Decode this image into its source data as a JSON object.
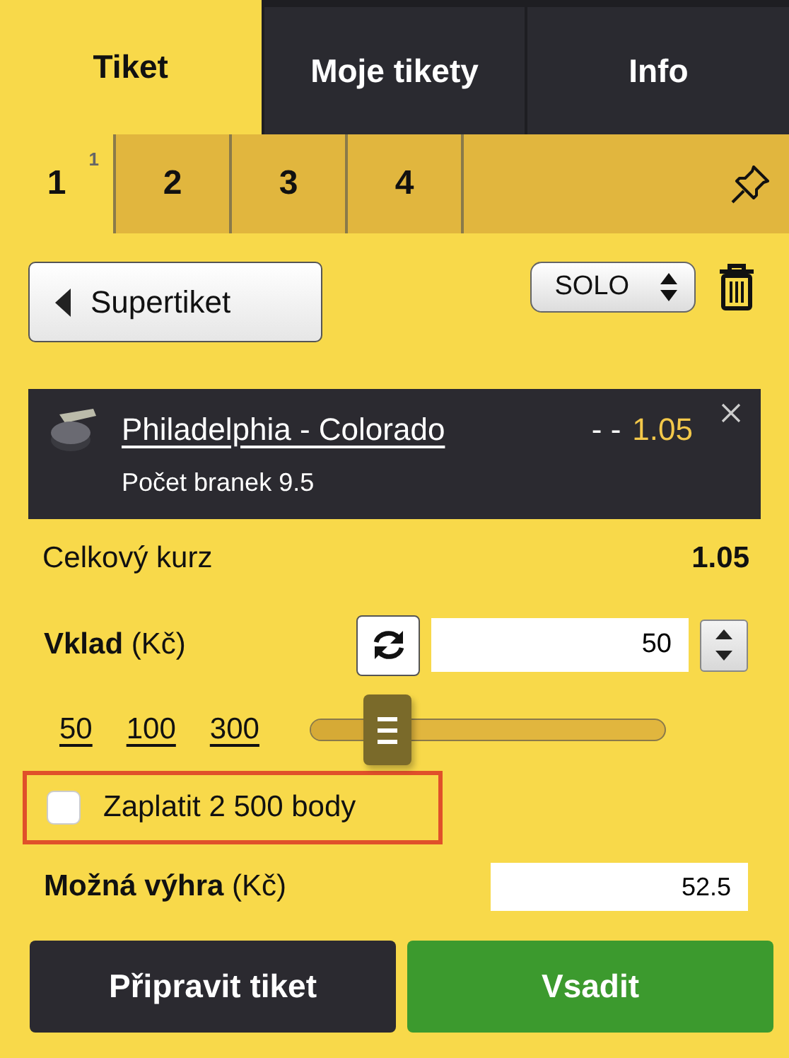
{
  "main_tabs": [
    {
      "label": "Tiket",
      "selected": true
    },
    {
      "label": "Moje tikety",
      "selected": false
    },
    {
      "label": "Info",
      "selected": false
    }
  ],
  "ticket_tabs": [
    {
      "label": "1",
      "count": "1",
      "selected": true
    },
    {
      "label": "2",
      "selected": false
    },
    {
      "label": "3",
      "selected": false
    },
    {
      "label": "4",
      "selected": false
    }
  ],
  "supertiket_button": "Supertiket",
  "mode_select": {
    "value": "SOLO"
  },
  "bets": [
    {
      "match": "Philadelphia - Colorado",
      "market": "Počet branek 9.5",
      "odds_prefix": "- -",
      "odds": "1.05"
    }
  ],
  "total_odds": {
    "label": "Celkový kurz",
    "value": "1.05"
  },
  "stake": {
    "label": "**Vklad** (Kč)",
    "value": "50",
    "quick_amounts": [
      "50",
      "100",
      "300"
    ],
    "level": 0.17
  },
  "points_option": {
    "label": "Zaplatit 2 500 body",
    "checked": false,
    "highlighted": true
  },
  "possible_win": {
    "label": "**Možná výhra** (Kč)",
    "value": "52.5"
  },
  "buttons": [
    {
      "label": "Připravit tiket",
      "kind": "secondary"
    },
    {
      "label": "Vsadit",
      "kind": "primary"
    }
  ]
}
